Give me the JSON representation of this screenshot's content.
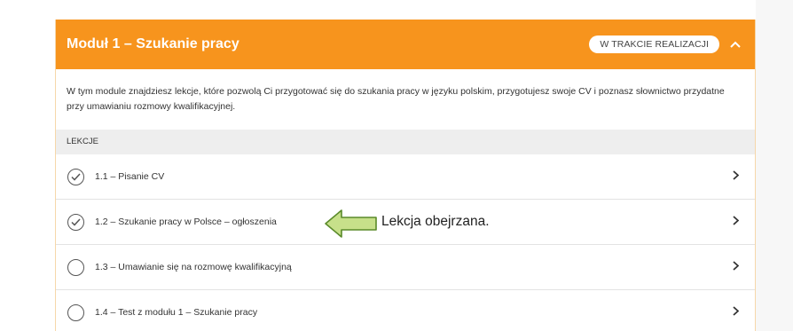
{
  "module": {
    "title": "Moduł 1 – Szukanie pracy",
    "status": "W TRAKCIE REALIZACJI",
    "description": "W tym module znajdziesz lekcje, które pozwolą Ci przygotować się do szukania pracy w języku polskim, przygotujesz swoje CV i poznasz słownictwo przydatne przy umawianiu rozmowy kwalifikacyjnej."
  },
  "lessons_header": "LEKCJE",
  "lessons": [
    {
      "label": "1.1 – Pisanie CV",
      "completed": true
    },
    {
      "label": "1.2 – Szukanie pracy w Polsce – ogłoszenia",
      "completed": true
    },
    {
      "label": "1.3 – Umawianie się na rozmowę kwalifikacyjną",
      "completed": false
    },
    {
      "label": "1.4 – Test z modułu 1 – Szukanie pracy",
      "completed": false
    }
  ],
  "annotation": {
    "text": "Lekcja obejrzana."
  },
  "colors": {
    "accent": "#f7941d",
    "arrow_fill": "#c7e08a",
    "arrow_stroke": "#5a8a2a"
  },
  "icons": {
    "collapse": "chevron-up-icon",
    "lesson_done": "check-circle-icon",
    "lesson_todo": "empty-circle-icon",
    "row_open": "chevron-right-icon",
    "annotation": "left-arrow-icon"
  }
}
